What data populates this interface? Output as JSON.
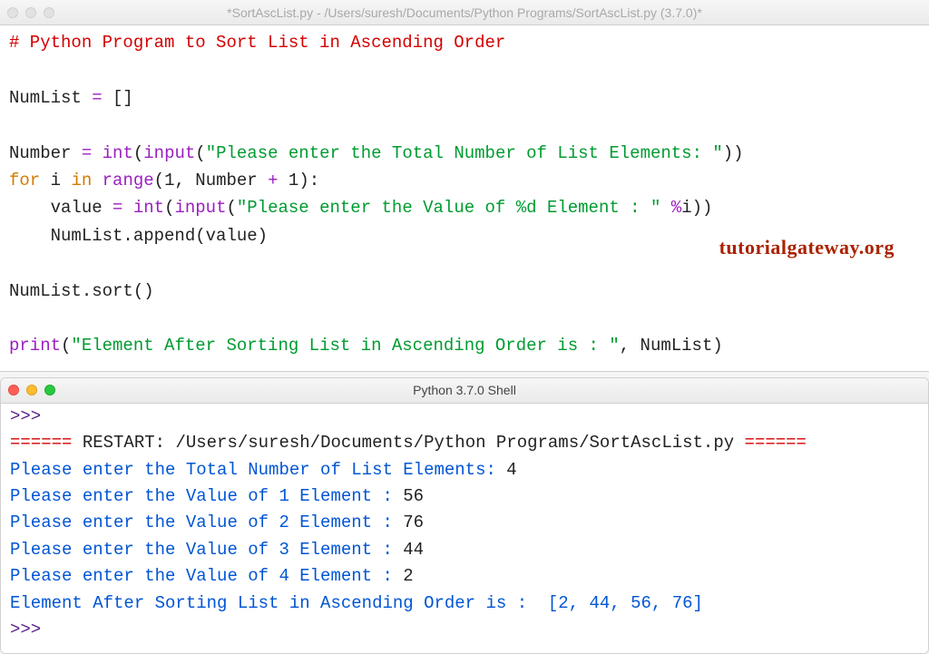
{
  "editor": {
    "title": "*SortAscList.py - /Users/suresh/Documents/Python Programs/SortAscList.py (3.7.0)*",
    "code": {
      "comment": "# Python Program to Sort List in Ascending Order",
      "l1_a": "NumList ",
      "l1_b": "=",
      "l1_c": " []",
      "l2_a": "Number ",
      "l2_b": "=",
      "l2_c": " ",
      "l2_int": "int",
      "l2_d": "(",
      "l2_input": "input",
      "l2_e": "(",
      "l2_str": "\"Please enter the Total Number of List Elements: \"",
      "l2_f": "))",
      "l3_for": "for",
      "l3_a": " i ",
      "l3_in": "in",
      "l3_b": " ",
      "l3_range": "range",
      "l3_c": "(",
      "l3_one": "1",
      "l3_d": ", Number ",
      "l3_plus": "+",
      "l3_e": " ",
      "l3_one2": "1",
      "l3_f": "):",
      "l4_a": "    value ",
      "l4_b": "=",
      "l4_c": " ",
      "l4_int": "int",
      "l4_d": "(",
      "l4_input": "input",
      "l4_e": "(",
      "l4_str": "\"Please enter the Value of %d Element : \"",
      "l4_f": " ",
      "l4_pct": "%",
      "l4_g": "i))",
      "l5_a": "    NumList.append(value)",
      "l6_a": "NumList.sort()",
      "l7_print": "print",
      "l7_a": "(",
      "l7_str": "\"Element After Sorting List in Ascending Order is : \"",
      "l7_b": ", NumList)"
    }
  },
  "shell": {
    "title": "Python 3.7.0 Shell",
    "prompt": ">>> ",
    "restart_eq": "======",
    "restart_label": " RESTART: /Users/suresh/Documents/Python Programs/SortAscList.py ",
    "line1_p": "Please enter the Total Number of List Elements: ",
    "line1_v": "4",
    "line2_p": "Please enter the Value of 1 Element : ",
    "line2_v": "56",
    "line3_p": "Please enter the Value of 2 Element : ",
    "line3_v": "76",
    "line4_p": "Please enter the Value of 3 Element : ",
    "line4_v": "44",
    "line5_p": "Please enter the Value of 4 Element : ",
    "line5_v": "2",
    "result_p": "Element After Sorting List in Ascending Order is :  ",
    "result_v": "[2, 44, 56, 76]"
  },
  "watermark": "tutorialgateway.org"
}
